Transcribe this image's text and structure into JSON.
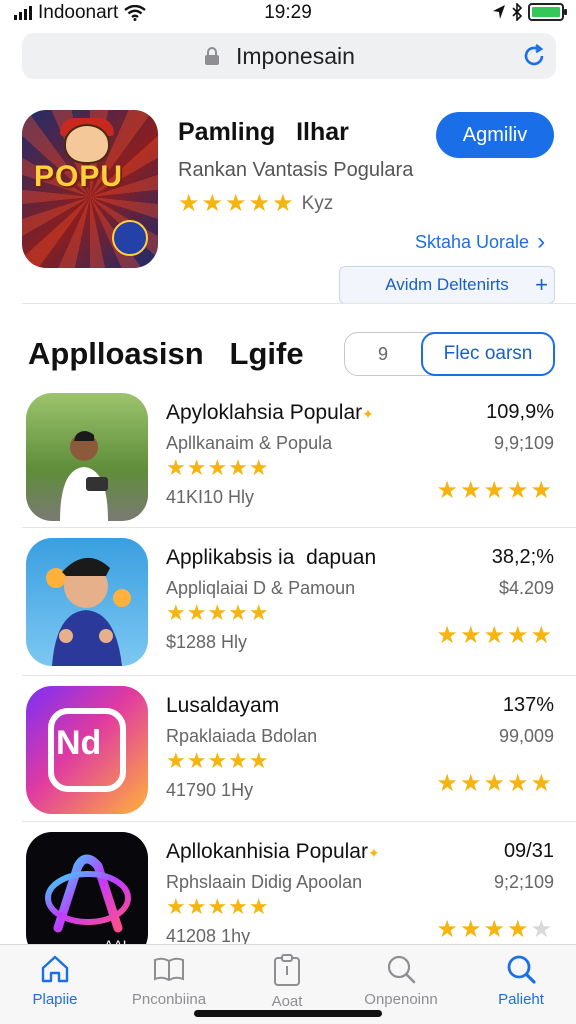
{
  "status_bar": {
    "carrier": "Indoonart",
    "time": "19:29"
  },
  "url_bar": {
    "url": "Imponesain"
  },
  "featured": {
    "title": "Pamling   Ilhar",
    "subtitle": "Rankan Vantasis Pogulara",
    "rating_count": "Kyz",
    "rating": 4.5,
    "logo_text": "POPU",
    "button_label": "Agmiliv",
    "see_all_label": "Sktaha Uorale",
    "secondary_button_label": "Avidm Deltenirts"
  },
  "section": {
    "title": "Applloasisn   Lgife",
    "segment_left": "9",
    "segment_right": "Flec oarsn"
  },
  "apps": [
    {
      "name": "Apyloklahsia Popular",
      "subtitle": "Apllkanaim & Popula",
      "count": "41KI10  Hly",
      "percent": "109,9%",
      "price": "9,9;109",
      "rating": 4.5,
      "right_rating": 5
    },
    {
      "name": "Applikabsis ia  dapuan",
      "subtitle": "Appliqlaiai D & Pamoun",
      "count": "$1288  Hly",
      "percent": "38,2;%",
      "price": "$4.209",
      "rating": 4.5,
      "right_rating": 5
    },
    {
      "name": "Lusaldayam",
      "subtitle": "Rpaklaiada  Bdolan",
      "count": "41790  1Hy",
      "percent": "137%",
      "price": "99,009",
      "rating": 4.5,
      "right_rating": 5,
      "icon_text": "Nd"
    },
    {
      "name": "Apllokanhisia Popular",
      "subtitle": "Rphslaain Didig Apoolan",
      "count": "41208  1hy",
      "percent": "09/31",
      "price": "9;2;109",
      "rating": 4.5,
      "right_rating": 4,
      "icon_text": "AAI"
    }
  ],
  "tab_bar": {
    "tabs": [
      {
        "label": "Plapiie",
        "icon": "home-icon",
        "active": true
      },
      {
        "label": "Pnconbiina",
        "icon": "book-icon",
        "active": false
      },
      {
        "label": "Aoat",
        "icon": "clipboard-icon",
        "active": false
      },
      {
        "label": "Onpenoinn",
        "icon": "search-outline-icon",
        "active": false
      },
      {
        "label": "Palieht",
        "icon": "search-icon",
        "active": true
      }
    ]
  },
  "colors": {
    "accent": "#1a6fe8",
    "star": "#f6b40e",
    "battery": "#34c759"
  }
}
